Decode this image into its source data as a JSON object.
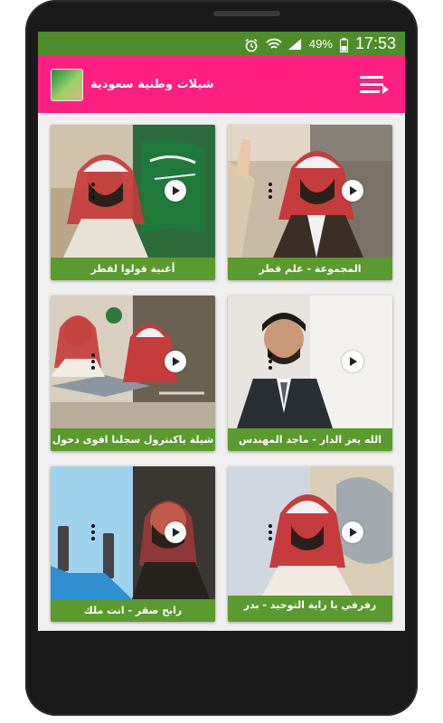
{
  "status": {
    "battery": "49%",
    "time": "17:53",
    "icons": [
      "alarm-icon",
      "wifi-icon",
      "signal-icon",
      "battery-icon"
    ]
  },
  "appbar": {
    "title": "شيلات وطنية سعودية",
    "menu_icon": "menu-icon",
    "background": "#ff1f80"
  },
  "colors": {
    "status_green": "#4e8e2a",
    "caption_green": "#5a9a2e"
  },
  "cards": [
    {
      "caption": "المجموعة - علم قطر"
    },
    {
      "caption": "أغنية قولوا لقطر"
    },
    {
      "caption": "الله يعز الدار - ماجد المهندس"
    },
    {
      "caption": "شيلة ياكنترول سجلنا اقوى دخول"
    },
    {
      "caption": "رفرفي يا راية التوحيد - بدر"
    },
    {
      "caption": "رابح صقر - انت ملك"
    }
  ]
}
